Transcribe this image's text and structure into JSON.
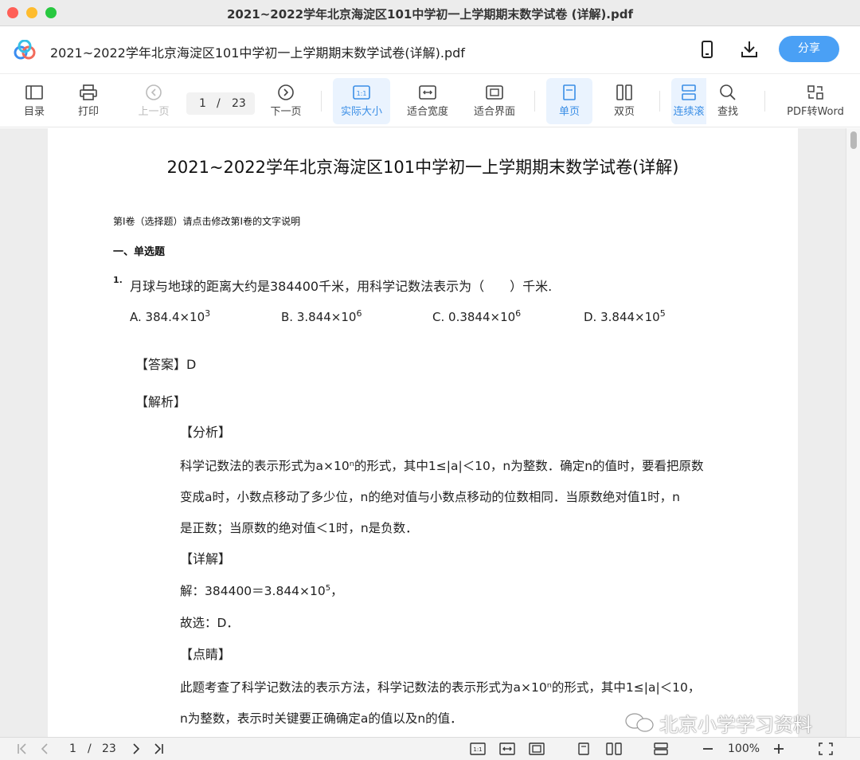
{
  "window": {
    "title": "2021~2022学年北京海淀区101中学初一上学期期末数学试卷 (详解).pdf"
  },
  "header": {
    "doc_name": "2021~2022学年北京海淀区101中学初一上学期期末数学试卷(详解).pdf",
    "share_label": "分享"
  },
  "toolbar": {
    "toc": "目录",
    "print": "打印",
    "prev": "上一页",
    "page_current": "1",
    "page_sep": "/",
    "page_total": "23",
    "next": "下一页",
    "actual_size": "实际大小",
    "fit_width": "适合宽度",
    "fit_page": "适合界面",
    "single": "单页",
    "double": "双页",
    "continuous": "连续滚",
    "find": "查找",
    "to_word": "PDF转Word"
  },
  "document": {
    "title": "2021~2022学年北京海淀区101中学初一上学期期末数学试卷(详解)",
    "volume_note": "第Ⅰ卷（选择题）请点击修改第Ⅰ卷的文字说明",
    "section": "一、单选题",
    "question_number": "1.",
    "question_text": "月球与地球的距离大约是384400千米，用科学记数法表示为（　　）千米.",
    "options": [
      {
        "label": "A.",
        "base": "384.4×10",
        "exp": "3"
      },
      {
        "label": "B.",
        "base": "3.844×10",
        "exp": "6"
      },
      {
        "label": "C.",
        "base": "0.3844×10",
        "exp": "6"
      },
      {
        "label": "D.",
        "base": "3.844×10",
        "exp": "5"
      }
    ],
    "answer": "【答案】D",
    "analysis_heading": "【解析】",
    "fenxi_heading": "【分析】",
    "fenxi_lines": [
      "科学记数法的表示形式为a×10ⁿ的形式，其中1≤|a|＜10，n为整数．确定n的值时，要看把原数",
      "变成a时，小数点移动了多少位，n的绝对值与小数点移动的位数相同．当原数绝对值1时，n",
      "是正数；当原数的绝对值＜1时，n是负数．"
    ],
    "detail_heading": "【详解】",
    "solution_base": "解：384400＝3.844×10",
    "solution_exp": "5",
    "solution_tail": "，",
    "choice": "故选：D．",
    "dianjing_heading": "【点睛】",
    "dianjing_lines": [
      "此题考查了科学记数法的表示方法，科学记数法的表示形式为a×10ⁿ的形式，其中1≤|a|＜10，",
      "n为整数，表示时关键要正确确定a的值以及n的值．"
    ],
    "watermark": "北京小学学习资料"
  },
  "statusbar": {
    "page_current": "1",
    "page_sep": "/",
    "page_total": "23",
    "zoom": "100%"
  },
  "colors": {
    "accent": "#4aa0f5",
    "active_bg": "#eaf3fe"
  }
}
